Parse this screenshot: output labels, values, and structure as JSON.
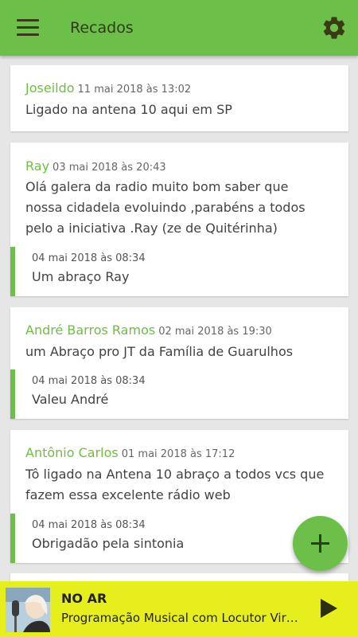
{
  "header": {
    "title": "Recados",
    "menu_icon": "hamburger-menu-icon",
    "settings_icon": "gear-icon"
  },
  "colors": {
    "accent": "#6cc04a",
    "player_bg": "#e6ee1c",
    "background": "#e6e6e6"
  },
  "messages": [
    {
      "author": "Joseildo",
      "date": "11 mai 2018 às 13:02",
      "text": "Ligado na antena 10 aqui em SP"
    },
    {
      "author": "Ray",
      "date": "03 mai 2018 às 20:43",
      "text_lines": [
        "Olá galera da radio muito bom saber que",
        "nossa cidadela evoluindo ,parabéns a todos",
        "pelo a iniciativa .Ray (ze de Quitérinha)"
      ],
      "reply": {
        "date": "04 mai 2018 às 08:34",
        "text": "Um abraço Ray"
      }
    },
    {
      "author": "André Barros Ramos",
      "date": "02 mai 2018 às 19:30",
      "text": "um Abraço pro JT da Família de Guarulhos",
      "reply": {
        "date": "04 mai 2018 às 08:34",
        "text": "Valeu André"
      }
    },
    {
      "author": "Antônio Carlos",
      "date": "01 mai 2018 às 17:12",
      "text_lines": [
        "Tô ligado na Antena 10 abraço a todos vcs que",
        "fazem essa excelente rádio web"
      ],
      "reply": {
        "date": "04 mai 2018 às 08:34",
        "text": "Obrigadão pela sintonia"
      }
    }
  ],
  "fab": {
    "icon": "plus-icon"
  },
  "player": {
    "status": "NO AR",
    "program": "Programação Musical com Locutor Virtual",
    "play_icon": "play-icon"
  }
}
